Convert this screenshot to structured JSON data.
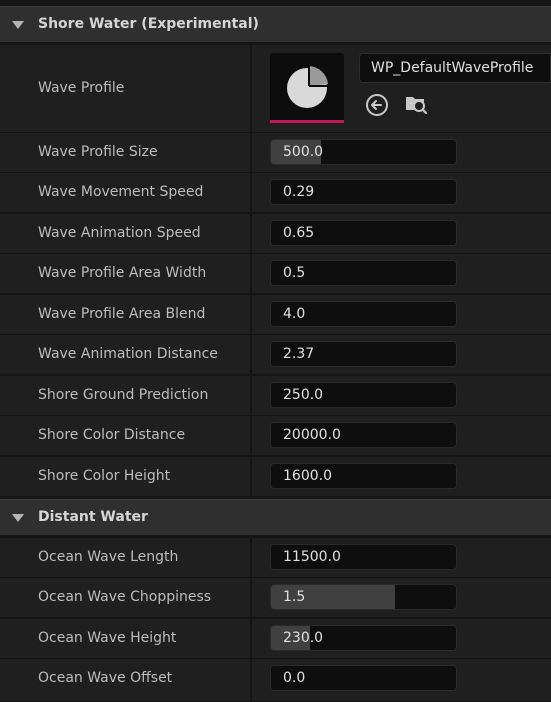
{
  "sections": [
    {
      "title": "Shore Water (Experimental)",
      "profile": {
        "label": "Wave Profile",
        "asset": "WP_DefaultWaveProfile"
      },
      "rows": [
        {
          "label": "Wave Profile Size",
          "value": "500.0",
          "fill": 0.27
        },
        {
          "label": "Wave Movement Speed",
          "value": "0.29",
          "fill": 0
        },
        {
          "label": "Wave Animation Speed",
          "value": "0.65",
          "fill": 0
        },
        {
          "label": "Wave Profile Area Width",
          "value": "0.5",
          "fill": 0
        },
        {
          "label": "Wave Profile Area Blend",
          "value": "4.0",
          "fill": 0
        },
        {
          "label": "Wave Animation Distance",
          "value": "2.37",
          "fill": 0
        },
        {
          "label": "Shore Ground Prediction",
          "value": "250.0",
          "fill": 0
        },
        {
          "label": "Shore Color Distance",
          "value": "20000.0",
          "fill": 0
        },
        {
          "label": "Shore Color Height",
          "value": "1600.0",
          "fill": 0
        }
      ]
    },
    {
      "title": "Distant Water",
      "rows": [
        {
          "label": "Ocean Wave Length",
          "value": "11500.0",
          "fill": 0
        },
        {
          "label": "Ocean Wave Choppiness",
          "value": "1.5",
          "fill": 0.67
        },
        {
          "label": "Ocean Wave Height",
          "value": "230.0",
          "fill": 0.21
        },
        {
          "label": "Ocean Wave Offset",
          "value": "0.0",
          "fill": 0
        }
      ]
    }
  ],
  "icons": {
    "collapse": "chevron-down-icon",
    "thumbnail": "wave-profile-thumbnail-icon",
    "use_selected": "arrow-left-circle-icon",
    "browse": "browse-folder-icon"
  },
  "colors": {
    "accent": "#c2185b",
    "header_bg": "#2f2f2f",
    "row_bg": "#1f1f1f",
    "field_bg": "#0e0e0e"
  }
}
